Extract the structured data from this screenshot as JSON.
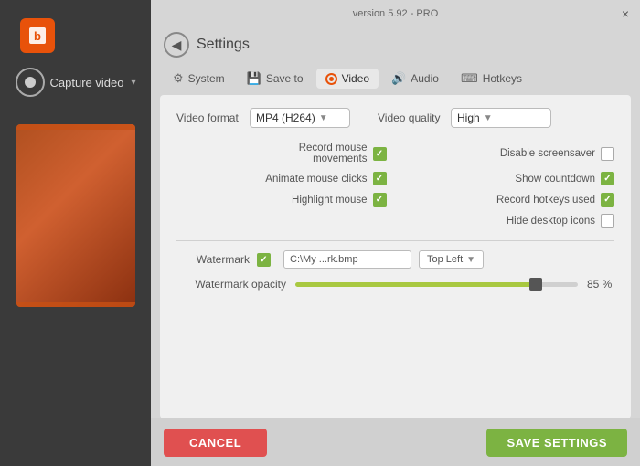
{
  "app": {
    "version": "version 5.92 - PRO",
    "close_label": "×"
  },
  "sidebar": {
    "logo_alt": "Bandicam logo",
    "capture_label": "Capture video",
    "dropdown_arrow": "▾"
  },
  "header": {
    "back_arrow": "◀",
    "title": "Settings"
  },
  "tabs": [
    {
      "id": "system",
      "label": "System",
      "icon": "⚙"
    },
    {
      "id": "save_to",
      "label": "Save to",
      "icon": "⬛"
    },
    {
      "id": "video",
      "label": "Video",
      "icon": "⦿",
      "active": true
    },
    {
      "id": "audio",
      "label": "Audio",
      "icon": "🔊"
    },
    {
      "id": "hotkeys",
      "label": "Hotkeys",
      "icon": "⌨"
    }
  ],
  "video_settings": {
    "format_label": "Video format",
    "format_value": "MP4 (H264)",
    "quality_label": "Video quality",
    "quality_value": "High",
    "checkboxes": {
      "record_mouse_label": "Record mouse movements",
      "record_mouse_checked": true,
      "animate_clicks_label": "Animate mouse clicks",
      "animate_clicks_checked": true,
      "highlight_mouse_label": "Highlight mouse",
      "highlight_mouse_checked": true,
      "disable_screensaver_label": "Disable screensaver",
      "disable_screensaver_checked": false,
      "show_countdown_label": "Show countdown",
      "show_countdown_checked": true,
      "record_hotkeys_label": "Record hotkeys used",
      "record_hotkeys_checked": true,
      "hide_icons_label": "Hide desktop icons",
      "hide_icons_checked": false
    },
    "watermark_label": "Watermark",
    "watermark_checked": true,
    "watermark_path": "C:\\My ...rk.bmp",
    "watermark_pos": "Top Left",
    "opacity_label": "Watermark opacity",
    "opacity_value": "85 %",
    "opacity_percent": 85
  },
  "buttons": {
    "cancel": "CANCEL",
    "save": "SAVE SETTINGS"
  }
}
